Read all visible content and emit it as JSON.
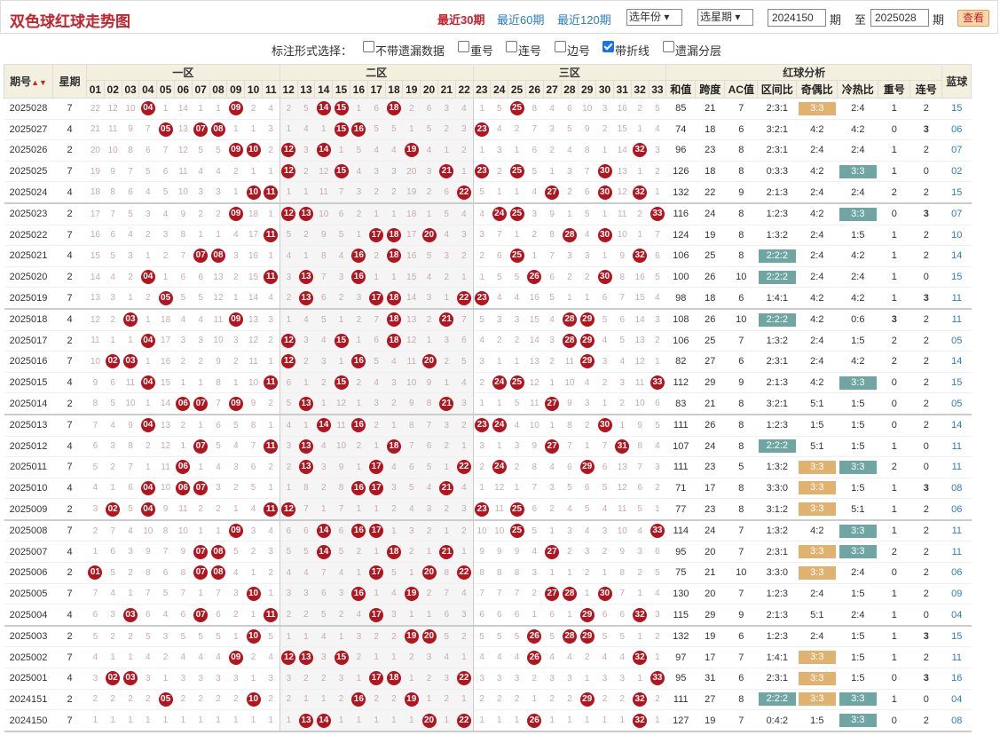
{
  "header": {
    "title": "双色球红球走势图",
    "recent": [
      "最近30期",
      "最近60期",
      "最近120期"
    ],
    "year_select": "选年份",
    "week_select": "选星期",
    "from_issue": "2024150",
    "qi1": "期",
    "to_label": "至",
    "to_issue": "2025028",
    "qi2": "期",
    "query_button": "查看"
  },
  "options": {
    "label": "标注形式选择：",
    "items": [
      {
        "label": "不带遗漏数据",
        "checked": false
      },
      {
        "label": "重号",
        "checked": false
      },
      {
        "label": "连号",
        "checked": false
      },
      {
        "label": "边号",
        "checked": false
      },
      {
        "label": "带折线",
        "checked": true
      },
      {
        "label": "遗漏分层",
        "checked": false
      }
    ]
  },
  "columns": {
    "issue": "期号",
    "week": "星期",
    "zones": [
      "一区",
      "二区",
      "三区"
    ],
    "analysis": "红球分析",
    "blue": "蓝球",
    "numbers": [
      "01",
      "02",
      "03",
      "04",
      "05",
      "06",
      "07",
      "08",
      "09",
      "10",
      "11",
      "12",
      "13",
      "14",
      "15",
      "16",
      "17",
      "18",
      "19",
      "20",
      "21",
      "22",
      "23",
      "24",
      "25",
      "26",
      "27",
      "28",
      "29",
      "30",
      "31",
      "32",
      "33"
    ],
    "analysis_cols": [
      "和值",
      "跨度",
      "AC值",
      "区间比",
      "奇偶比",
      "冷热比",
      "重号",
      "连号"
    ]
  },
  "colors": {
    "ball": "#b3141d",
    "highlight_green": "#6fa6a3",
    "highlight_orange": "#e0b270",
    "blue_text": "#2b7ec3"
  },
  "rows": [
    {
      "issue": "2025028",
      "week": "7",
      "balls": [
        4,
        9,
        14,
        15,
        18,
        25
      ],
      "sum": "85",
      "span": "21",
      "ac": "7",
      "zone": "2:3:1",
      "oe": "3:3",
      "hc": "2:4",
      "rep": "1",
      "con": "2",
      "blue": "15"
    },
    {
      "issue": "2025027",
      "week": "4",
      "balls": [
        5,
        7,
        8,
        15,
        16,
        23
      ],
      "sum": "74",
      "span": "18",
      "ac": "6",
      "zone": "3:2:1",
      "oe": "4:2",
      "hc": "4:2",
      "rep": "0",
      "con": "3",
      "blue": "06"
    },
    {
      "issue": "2025026",
      "week": "2",
      "balls": [
        9,
        10,
        12,
        14,
        19,
        32
      ],
      "sum": "96",
      "span": "23",
      "ac": "8",
      "zone": "2:3:1",
      "oe": "2:4",
      "hc": "2:4",
      "rep": "1",
      "con": "2",
      "blue": "07"
    },
    {
      "issue": "2025025",
      "week": "7",
      "balls": [
        12,
        15,
        21,
        23,
        25,
        30
      ],
      "sum": "126",
      "span": "18",
      "ac": "8",
      "zone": "0:3:3",
      "oe": "4:2",
      "hc": "3:3",
      "rep": "1",
      "con": "0",
      "blue": "02"
    },
    {
      "issue": "2025024",
      "week": "4",
      "balls": [
        10,
        11,
        22,
        27,
        30,
        32
      ],
      "sum": "132",
      "span": "22",
      "ac": "9",
      "zone": "2:1:3",
      "oe": "2:4",
      "hc": "2:4",
      "rep": "2",
      "con": "2",
      "blue": "15"
    },
    {
      "issue": "2025023",
      "week": "2",
      "balls": [
        9,
        12,
        13,
        24,
        25,
        33
      ],
      "sum": "116",
      "span": "24",
      "ac": "8",
      "zone": "1:2:3",
      "oe": "4:2",
      "hc": "3:3",
      "rep": "0",
      "con": "3",
      "blue": "07"
    },
    {
      "issue": "2025022",
      "week": "7",
      "balls": [
        11,
        17,
        18,
        20,
        28,
        30
      ],
      "sum": "124",
      "span": "19",
      "ac": "8",
      "zone": "1:3:2",
      "oe": "2:4",
      "hc": "1:5",
      "rep": "1",
      "con": "2",
      "blue": "10"
    },
    {
      "issue": "2025021",
      "week": "4",
      "balls": [
        7,
        8,
        16,
        18,
        25,
        32
      ],
      "sum": "106",
      "span": "25",
      "ac": "8",
      "zone": "2:2:2",
      "oe": "2:4",
      "hc": "4:2",
      "rep": "1",
      "con": "2",
      "blue": "14"
    },
    {
      "issue": "2025020",
      "week": "2",
      "balls": [
        4,
        11,
        13,
        16,
        26,
        30
      ],
      "sum": "100",
      "span": "26",
      "ac": "10",
      "zone": "2:2:2",
      "oe": "2:4",
      "hc": "2:4",
      "rep": "1",
      "con": "0",
      "blue": "15"
    },
    {
      "issue": "2025019",
      "week": "7",
      "balls": [
        5,
        13,
        17,
        18,
        22,
        23
      ],
      "sum": "98",
      "span": "18",
      "ac": "6",
      "zone": "1:4:1",
      "oe": "4:2",
      "hc": "4:2",
      "rep": "1",
      "con": "3",
      "blue": "11"
    },
    {
      "issue": "2025018",
      "week": "4",
      "balls": [
        3,
        9,
        18,
        21,
        28,
        29
      ],
      "sum": "108",
      "span": "26",
      "ac": "10",
      "zone": "2:2:2",
      "oe": "4:2",
      "hc": "0:6",
      "rep": "3",
      "con": "2",
      "blue": "11"
    },
    {
      "issue": "2025017",
      "week": "2",
      "balls": [
        4,
        12,
        15,
        18,
        28,
        29
      ],
      "sum": "106",
      "span": "25",
      "ac": "7",
      "zone": "1:3:2",
      "oe": "2:4",
      "hc": "1:5",
      "rep": "2",
      "con": "2",
      "blue": "05"
    },
    {
      "issue": "2025016",
      "week": "7",
      "balls": [
        2,
        3,
        12,
        16,
        20,
        29
      ],
      "sum": "82",
      "span": "27",
      "ac": "6",
      "zone": "2:3:1",
      "oe": "2:4",
      "hc": "4:2",
      "rep": "2",
      "con": "2",
      "blue": "14"
    },
    {
      "issue": "2025015",
      "week": "4",
      "balls": [
        4,
        11,
        15,
        24,
        25,
        33
      ],
      "sum": "112",
      "span": "29",
      "ac": "9",
      "zone": "2:1:3",
      "oe": "4:2",
      "hc": "3:3",
      "rep": "0",
      "con": "2",
      "blue": "15"
    },
    {
      "issue": "2025014",
      "week": "2",
      "balls": [
        6,
        7,
        9,
        13,
        21,
        27
      ],
      "sum": "83",
      "span": "21",
      "ac": "8",
      "zone": "3:2:1",
      "oe": "5:1",
      "hc": "1:5",
      "rep": "0",
      "con": "2",
      "blue": "05"
    },
    {
      "issue": "2025013",
      "week": "7",
      "balls": [
        4,
        14,
        16,
        23,
        24,
        30
      ],
      "sum": "111",
      "span": "26",
      "ac": "8",
      "zone": "1:2:3",
      "oe": "1:5",
      "hc": "1:5",
      "rep": "0",
      "con": "2",
      "blue": "14"
    },
    {
      "issue": "2025012",
      "week": "4",
      "balls": [
        7,
        11,
        13,
        18,
        27,
        31
      ],
      "sum": "107",
      "span": "24",
      "ac": "8",
      "zone": "2:2:2",
      "oe": "5:1",
      "hc": "1:5",
      "rep": "1",
      "con": "0",
      "blue": "11"
    },
    {
      "issue": "2025011",
      "week": "7",
      "balls": [
        6,
        13,
        17,
        22,
        24,
        29
      ],
      "sum": "111",
      "span": "23",
      "ac": "5",
      "zone": "1:3:2",
      "oe": "3:3",
      "hc": "3:3",
      "rep": "2",
      "con": "0",
      "blue": "11"
    },
    {
      "issue": "2025010",
      "week": "4",
      "balls": [
        4,
        6,
        7,
        16,
        17,
        21
      ],
      "sum": "71",
      "span": "17",
      "ac": "8",
      "zone": "3:3:0",
      "oe": "3:3",
      "hc": "1:5",
      "rep": "1",
      "con": "3",
      "blue": "08"
    },
    {
      "issue": "2025009",
      "week": "2",
      "balls": [
        2,
        4,
        12,
        23,
        25,
        11
      ],
      "sum": "77",
      "span": "23",
      "ac": "8",
      "zone": "3:1:2",
      "oe": "3:3",
      "hc": "5:1",
      "rep": "1",
      "con": "2",
      "blue": "06"
    },
    {
      "issue": "2025008",
      "week": "7",
      "balls": [
        9,
        14,
        16,
        17,
        25,
        33
      ],
      "sum": "114",
      "span": "24",
      "ac": "7",
      "zone": "1:3:2",
      "oe": "4:2",
      "hc": "3:3",
      "rep": "1",
      "con": "2",
      "blue": "11"
    },
    {
      "issue": "2025007",
      "week": "4",
      "balls": [
        7,
        8,
        14,
        18,
        21,
        27
      ],
      "sum": "95",
      "span": "20",
      "ac": "7",
      "zone": "2:3:1",
      "oe": "3:3",
      "hc": "3:3",
      "rep": "2",
      "con": "2",
      "blue": "11"
    },
    {
      "issue": "2025006",
      "week": "2",
      "balls": [
        1,
        7,
        8,
        17,
        20,
        22
      ],
      "sum": "75",
      "span": "21",
      "ac": "10",
      "zone": "3:3:0",
      "oe": "3:3",
      "hc": "2:4",
      "rep": "0",
      "con": "2",
      "blue": "06"
    },
    {
      "issue": "2025005",
      "week": "7",
      "balls": [
        10,
        16,
        19,
        27,
        28,
        30
      ],
      "sum": "130",
      "span": "20",
      "ac": "7",
      "zone": "1:2:3",
      "oe": "2:4",
      "hc": "1:5",
      "rep": "1",
      "con": "2",
      "blue": "09"
    },
    {
      "issue": "2025004",
      "week": "4",
      "balls": [
        3,
        7,
        17,
        29,
        32,
        11
      ],
      "sum": "115",
      "span": "29",
      "ac": "9",
      "zone": "2:1:3",
      "oe": "5:1",
      "hc": "2:4",
      "rep": "1",
      "con": "0",
      "blue": "04"
    },
    {
      "issue": "2025003",
      "week": "2",
      "balls": [
        10,
        19,
        20,
        26,
        28,
        29
      ],
      "sum": "132",
      "span": "19",
      "ac": "6",
      "zone": "1:2:3",
      "oe": "2:4",
      "hc": "1:5",
      "rep": "1",
      "con": "3",
      "blue": "15"
    },
    {
      "issue": "2025002",
      "week": "7",
      "balls": [
        9,
        12,
        13,
        15,
        26,
        32
      ],
      "sum": "97",
      "span": "17",
      "ac": "7",
      "zone": "1:4:1",
      "oe": "3:3",
      "hc": "1:5",
      "rep": "1",
      "con": "2",
      "blue": "11"
    },
    {
      "issue": "2025001",
      "week": "4",
      "balls": [
        2,
        3,
        17,
        18,
        22,
        33
      ],
      "sum": "95",
      "span": "31",
      "ac": "6",
      "zone": "2:3:1",
      "oe": "3:3",
      "hc": "1:5",
      "rep": "0",
      "con": "3",
      "blue": "16"
    },
    {
      "issue": "2024151",
      "week": "2",
      "balls": [
        5,
        10,
        16,
        19,
        29,
        32
      ],
      "sum": "111",
      "span": "27",
      "ac": "8",
      "zone": "2:2:2",
      "oe": "3:3",
      "hc": "3:3",
      "rep": "1",
      "con": "0",
      "blue": "04"
    },
    {
      "issue": "2024150",
      "week": "7",
      "balls": [
        13,
        14,
        20,
        22,
        26,
        32
      ],
      "sum": "127",
      "span": "19",
      "ac": "7",
      "zone": "0:4:2",
      "oe": "1:5",
      "hc": "3:3",
      "rep": "0",
      "con": "2",
      "blue": "08"
    }
  ]
}
